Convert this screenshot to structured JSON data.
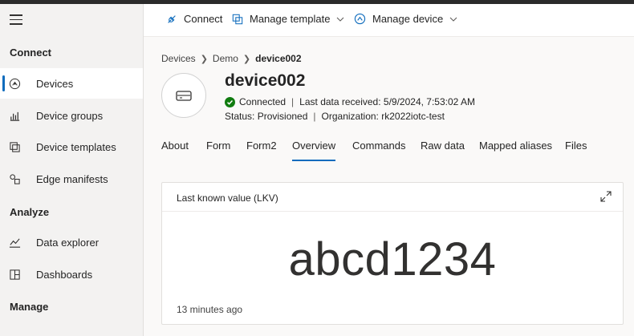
{
  "sidebar": {
    "sections": {
      "connect": "Connect",
      "analyze": "Analyze",
      "manage": "Manage"
    },
    "items": [
      {
        "label": "Devices",
        "icon": "devices-icon",
        "active": true
      },
      {
        "label": "Device groups",
        "icon": "device-groups-icon"
      },
      {
        "label": "Device templates",
        "icon": "device-templates-icon"
      },
      {
        "label": "Edge manifests",
        "icon": "edge-manifests-icon"
      },
      {
        "label": "Data explorer",
        "icon": "data-explorer-icon"
      },
      {
        "label": "Dashboards",
        "icon": "dashboards-icon"
      }
    ]
  },
  "commandbar": {
    "connect": "Connect",
    "manage_template": "Manage template",
    "manage_device": "Manage device"
  },
  "breadcrumb": [
    "Devices",
    "Demo",
    "device002"
  ],
  "device": {
    "name": "device002",
    "connection": "Connected",
    "last_data": "Last data received: 5/9/2024, 7:53:02 AM",
    "status": "Status: Provisioned",
    "organization": "Organization: rk2022iotc-test"
  },
  "tabs": [
    "About",
    "Form",
    "Form2",
    "Overview",
    "Commands",
    "Raw data",
    "Mapped aliases",
    "Files"
  ],
  "active_tab": "Overview",
  "tile": {
    "title": "Last known value (LKV)",
    "value": "abcd1234",
    "updated": "13 minutes ago"
  },
  "colors": {
    "accent": "#0f6cbd",
    "connected": "#107c10"
  }
}
